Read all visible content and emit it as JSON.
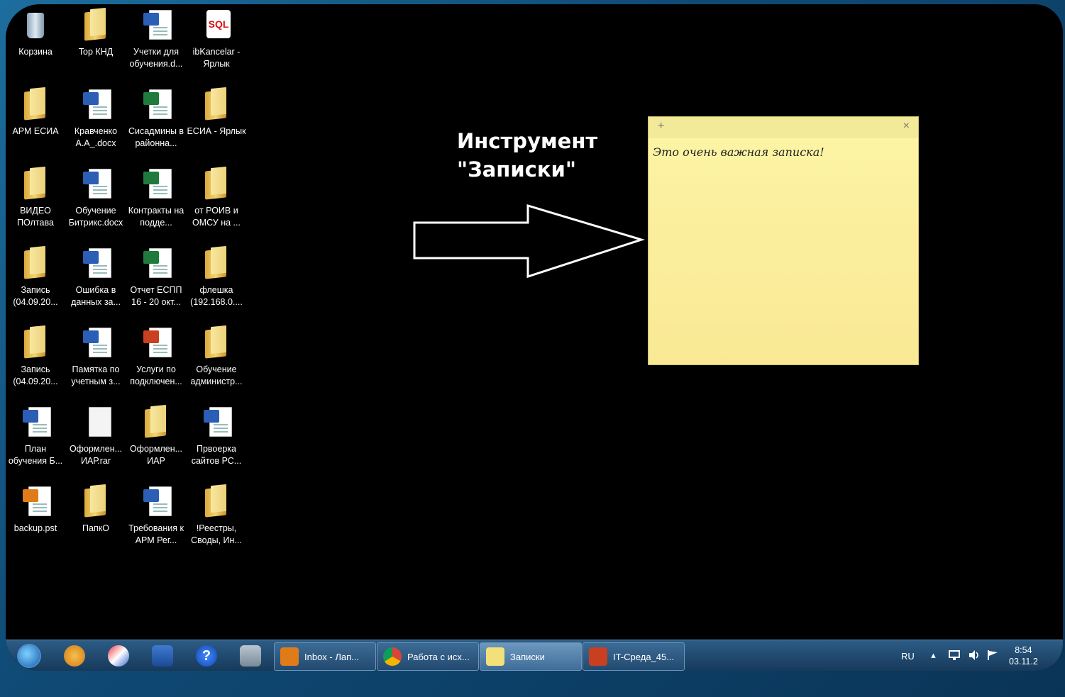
{
  "desktop": {
    "icons": [
      {
        "label": "Корзина",
        "type": "bin"
      },
      {
        "label": "Top КНД",
        "type": "folder"
      },
      {
        "label": "Учетки для обучения.d...",
        "type": "word"
      },
      {
        "label": "ibKancelar - Ярлык",
        "type": "sql",
        "badge": "SQL"
      },
      {
        "label": "АРМ ЕСИА",
        "type": "folder"
      },
      {
        "label": "Кравченко А.А_.docx",
        "type": "word"
      },
      {
        "label": "Сисадмины в районна...",
        "type": "excel"
      },
      {
        "label": "ЕСИА - Ярлык",
        "type": "folder"
      },
      {
        "label": "ВИДЕО ПОлтава",
        "type": "folder"
      },
      {
        "label": "Обучение Битрикс.docx",
        "type": "word"
      },
      {
        "label": "Контракты на подде...",
        "type": "excel"
      },
      {
        "label": "от РОИВ и ОМСУ на ...",
        "type": "folder"
      },
      {
        "label": "Запись (04.09.20...",
        "type": "folder"
      },
      {
        "label": "Ошибка в данных за...",
        "type": "word"
      },
      {
        "label": "Отчет ЕСПП 16 - 20 окт...",
        "type": "excel"
      },
      {
        "label": "флешка (192.168.0....",
        "type": "folder"
      },
      {
        "label": "Запись (04.09.20...",
        "type": "folder"
      },
      {
        "label": "Памятка по учетным з...",
        "type": "word"
      },
      {
        "label": "Услуги по подключен...",
        "type": "ppt"
      },
      {
        "label": "Обучение администр...",
        "type": "folder"
      },
      {
        "label": "План обучения Б...",
        "type": "word"
      },
      {
        "label": "Оформлен... ИАР.rar",
        "type": "blank"
      },
      {
        "label": "Оформлен... ИАР",
        "type": "folder"
      },
      {
        "label": "Првоерка сайтов РС...",
        "type": "word"
      },
      {
        "label": "backup.pst",
        "type": "outlook"
      },
      {
        "label": "ПапкО",
        "type": "folder"
      },
      {
        "label": "Требования к АРМ Рег...",
        "type": "word"
      },
      {
        "label": "!Реестры, Своды, Ин...",
        "type": "folder"
      }
    ]
  },
  "annotation": {
    "title_line1": "Инструмент",
    "title_line2": "\"Записки\""
  },
  "note": {
    "plus_glyph": "+",
    "close_glyph": "×",
    "text": "Это очень важная записка!"
  },
  "taskbar": {
    "help_glyph": "?",
    "buttons": [
      {
        "label": "Inbox - Лап...",
        "color": "#e07b1a"
      },
      {
        "label": "Работа с исх...",
        "color": "#2fa84f"
      },
      {
        "label": "Записки",
        "color": "#f3e07a"
      },
      {
        "label": "IT-Среда_45...",
        "color": "#c8401f"
      }
    ],
    "tray": {
      "lang": "RU",
      "up_glyph": "▲",
      "time": "8:54",
      "date": "03.11.2"
    }
  },
  "colors": {
    "note_bg": "#fdf7a6",
    "accent": "#2b5eb5"
  }
}
